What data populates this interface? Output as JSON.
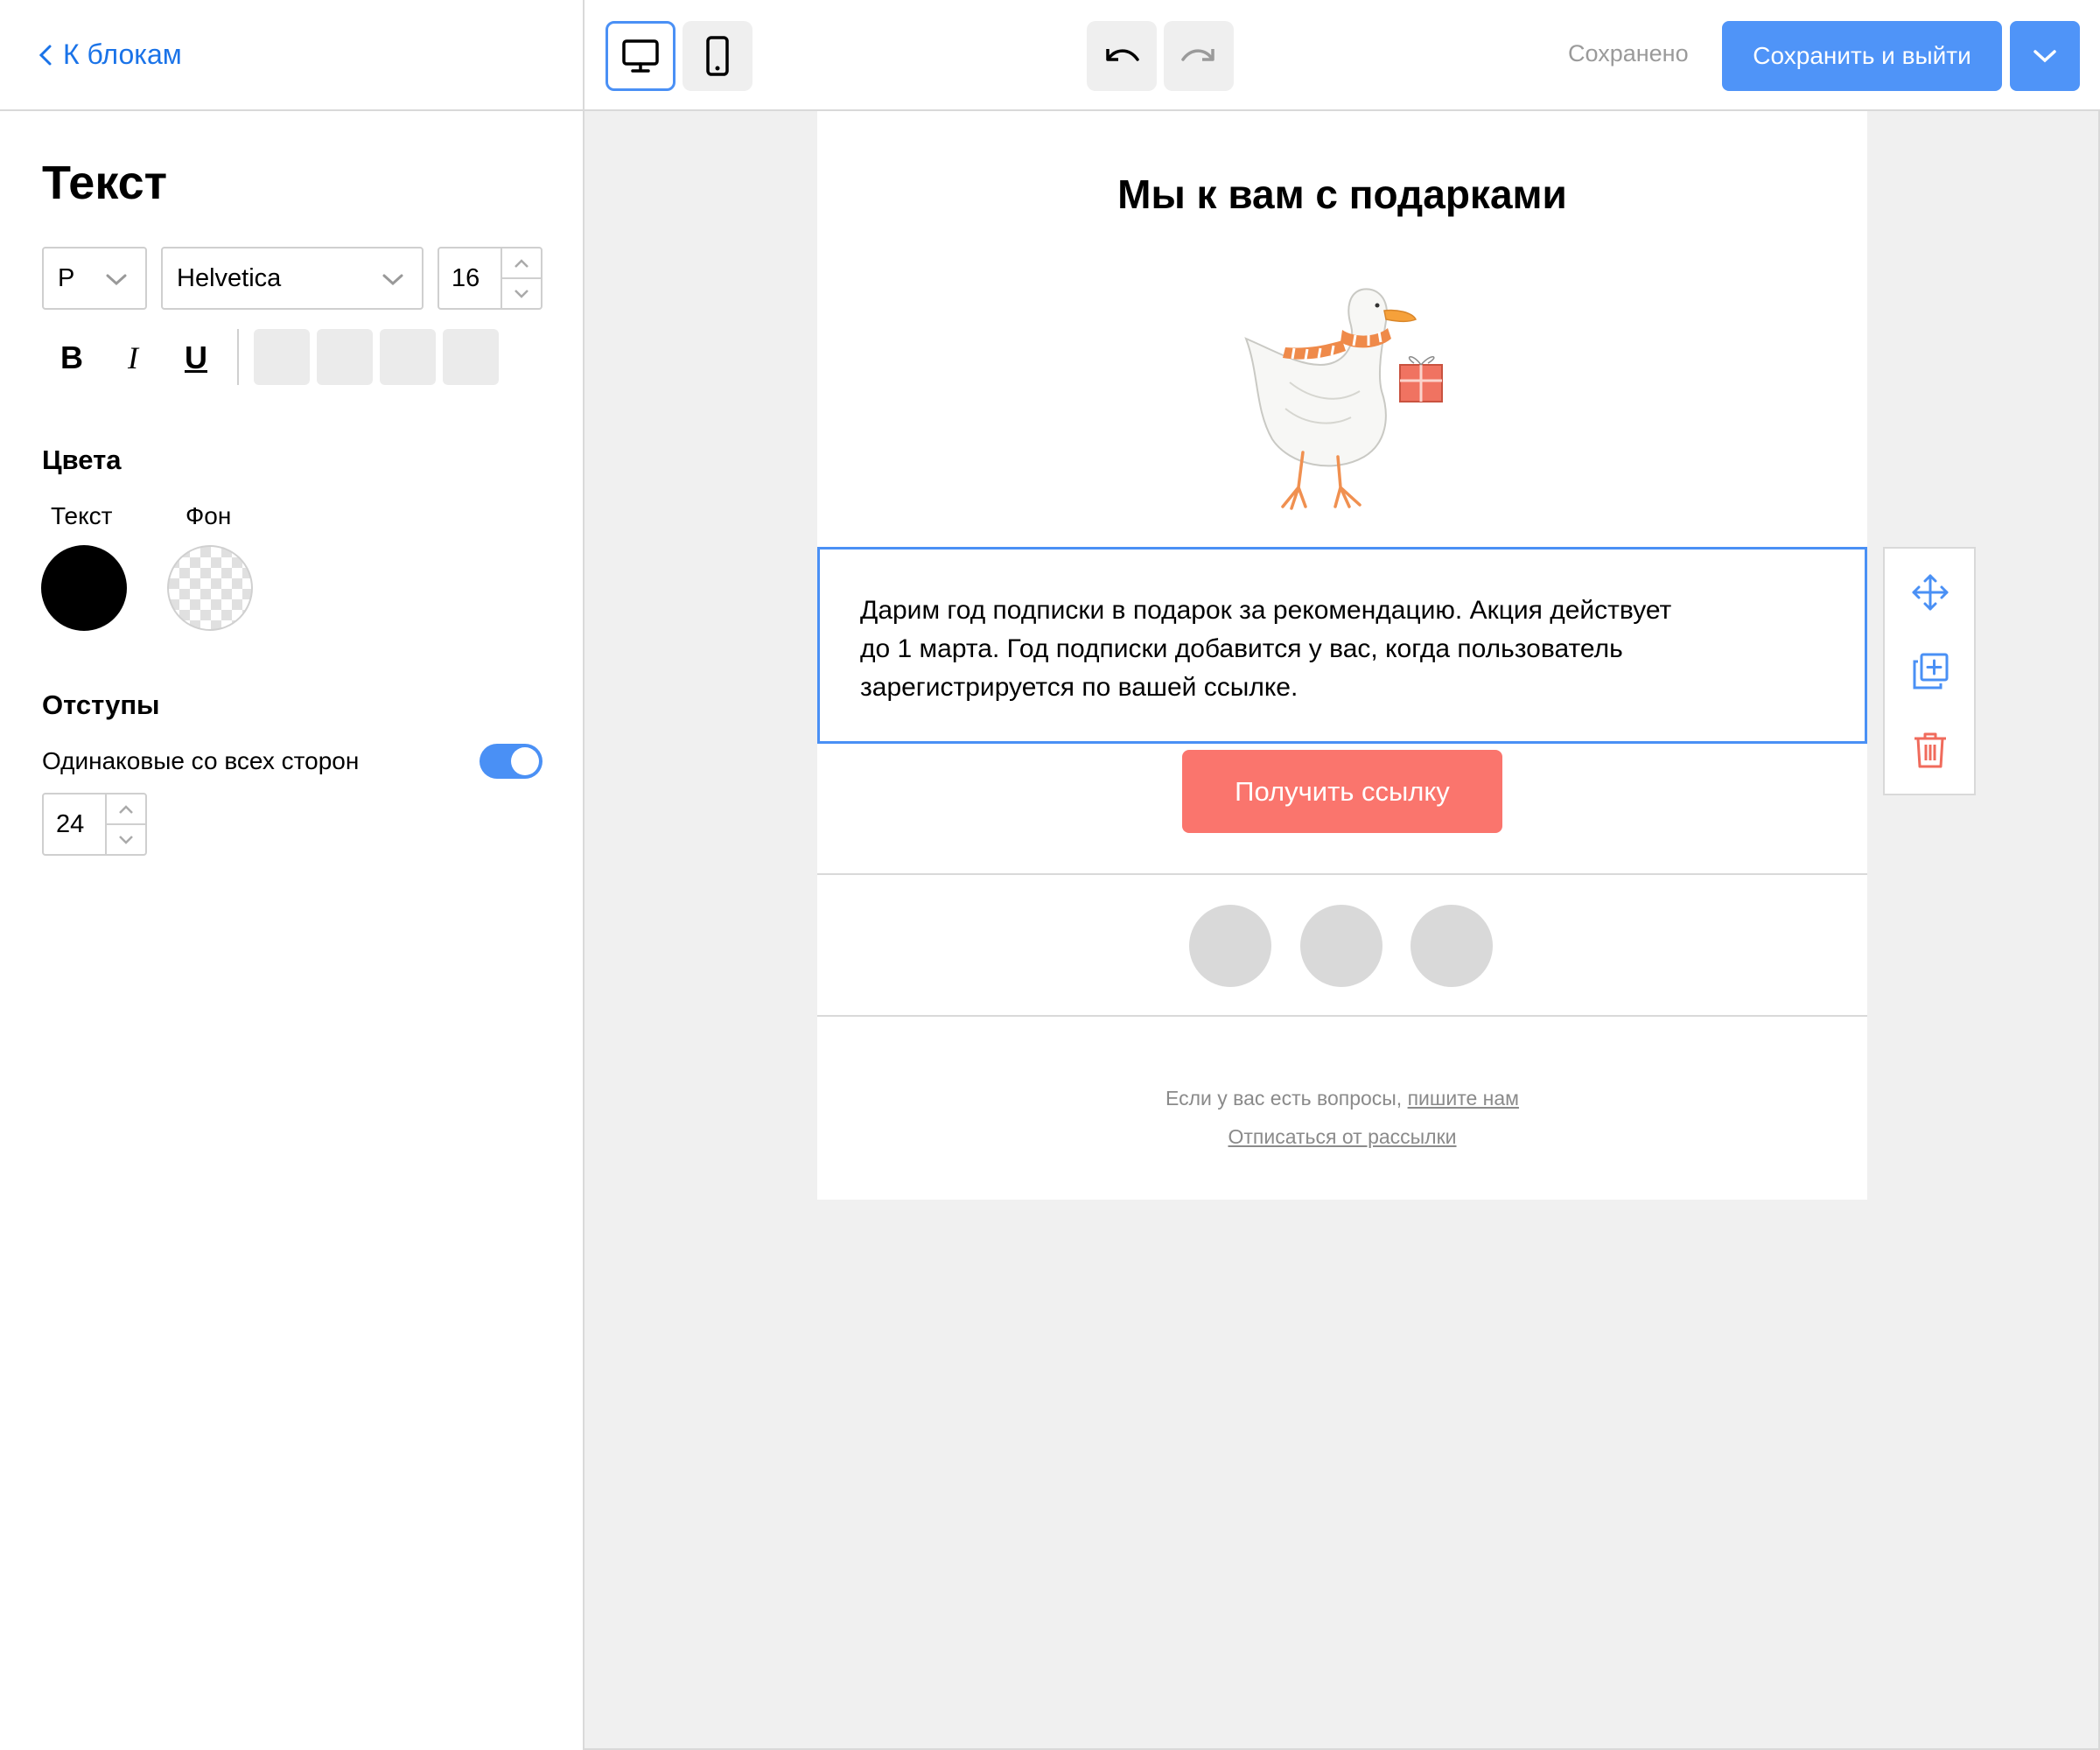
{
  "sidebar": {
    "back_label": "К блокам",
    "title": "Текст",
    "text_style": {
      "selected": "P"
    },
    "font": {
      "selected": "Helvetica"
    },
    "font_size": {
      "value": "16"
    },
    "format": {
      "bold": "B",
      "italic": "I",
      "underline": "U"
    },
    "colors": {
      "title": "Цвета",
      "text_label": "Текст",
      "text_color": "#000000",
      "bg_label": "Фон",
      "bg_color": "transparent"
    },
    "padding": {
      "title": "Отступы",
      "same_all_sides_label": "Одинаковые со всех сторон",
      "same_all_sides_on": true,
      "value": "24"
    }
  },
  "topbar": {
    "view_desktop_icon": "desktop-icon",
    "view_mobile_icon": "mobile-icon",
    "undo_icon": "undo-icon",
    "redo_icon": "redo-icon",
    "status": "Сохранено",
    "save_exit_label": "Сохранить и выйти",
    "accent_color": "#4f94f8"
  },
  "email": {
    "title": "Мы к вам с подарками",
    "image_icon": "goose-with-gift-illustration",
    "body_lines": [
      "Дарим год подписки в подарок за рекомендацию. Акция действует",
      "до 1 марта. Год подписки добавится у вас, когда пользователь",
      "зарегистрируется по вашей ссылке."
    ],
    "cta_label": "Получить ссылку",
    "cta_color": "#fa756d",
    "footer": {
      "question_text": "Если у вас есть вопросы,",
      "write_us_link": "пишите нам",
      "unsubscribe_link": "Отписаться от рассылки"
    }
  },
  "block_tools": [
    "move-icon",
    "duplicate-icon",
    "trash-icon"
  ]
}
